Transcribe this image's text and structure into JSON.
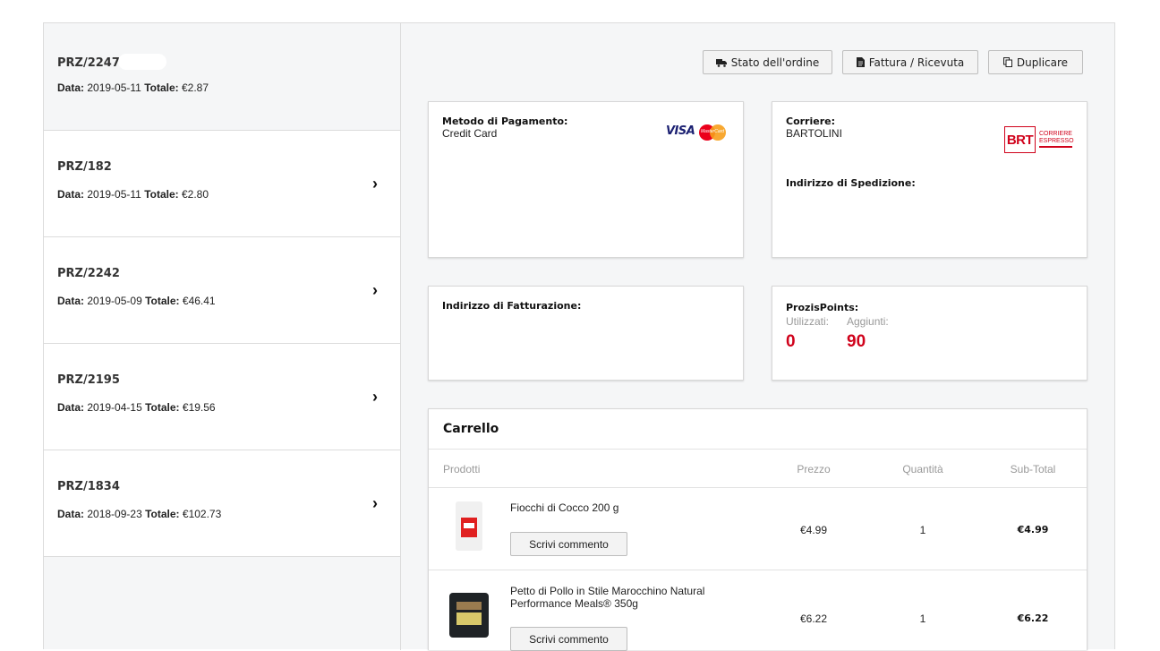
{
  "orders": [
    {
      "number": "PRZ/2247",
      "date_label": "Data:",
      "date": "2019-05-11",
      "total_label": "Totale:",
      "total": "€2.87"
    },
    {
      "number": "PRZ/182",
      "date_label": "Data:",
      "date": "2019-05-11",
      "total_label": "Totale:",
      "total": "€2.80"
    },
    {
      "number": "PRZ/2242",
      "date_label": "Data:",
      "date": "2019-05-09",
      "total_label": "Totale:",
      "total": "€46.41"
    },
    {
      "number": "PRZ/2195",
      "date_label": "Data:",
      "date": "2019-04-15",
      "total_label": "Totale:",
      "total": "€19.56"
    },
    {
      "number": "PRZ/1834",
      "date_label": "Data:",
      "date": "2018-09-23",
      "total_label": "Totale:",
      "total": "€102.73"
    }
  ],
  "actions": {
    "status": "Stato dell'ordine",
    "invoice": "Fattura / Ricevuta",
    "duplicate": "Duplicare"
  },
  "payment": {
    "label": "Metodo di Pagamento:",
    "value": "Credit Card",
    "brand_visa": "VISA",
    "brand_mc": "MasterCard"
  },
  "carrier": {
    "label": "Corriere:",
    "value": "BARTOLINI",
    "logo_text": "BRT",
    "logo_sub1": "CORRIERE",
    "logo_sub2": "ESPRESSO",
    "shipping_label": "Indirizzo di Spedizione:"
  },
  "billing": {
    "label": "Indirizzo di Fatturazione:"
  },
  "points": {
    "label": "ProzisPoints:",
    "used_label": "Utilizzati:",
    "used": "0",
    "added_label": "Aggiunti:",
    "added": "90",
    "color": "#d0021b"
  },
  "cart": {
    "title": "Carrello",
    "headers": {
      "products": "Prodotti",
      "price": "Prezzo",
      "qty": "Quantità",
      "subtotal": "Sub-Total"
    },
    "comment_label": "Scrivi commento",
    "items": [
      {
        "name": "Fiocchi di Cocco 200 g",
        "price": "€4.99",
        "qty": "1",
        "subtotal": "€4.99"
      },
      {
        "name": "Petto di Pollo in Stile Marocchino Natural Performance Meals® 350g",
        "price": "€6.22",
        "qty": "1",
        "subtotal": "€6.22"
      }
    ]
  }
}
